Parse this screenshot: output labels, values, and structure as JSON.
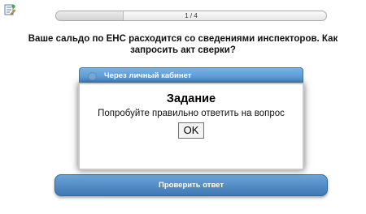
{
  "progress": {
    "label": "1 / 4",
    "fraction": 0.25
  },
  "question": "Ваше сальдо по ЕНС расходится со сведениями инспекторов. Как запросить акт сверки?",
  "options": [
    {
      "label": "Через личный кабинет",
      "selected": false
    }
  ],
  "check_button": "Проверить ответ",
  "dialog": {
    "title": "Задание",
    "message": "Попробуйте правильно ответить на вопрос",
    "ok": "OK"
  },
  "icons": {
    "top_left": "edit-note-icon"
  },
  "colors": {
    "accent": "#4b8cc9",
    "button": "#3f78b4"
  }
}
